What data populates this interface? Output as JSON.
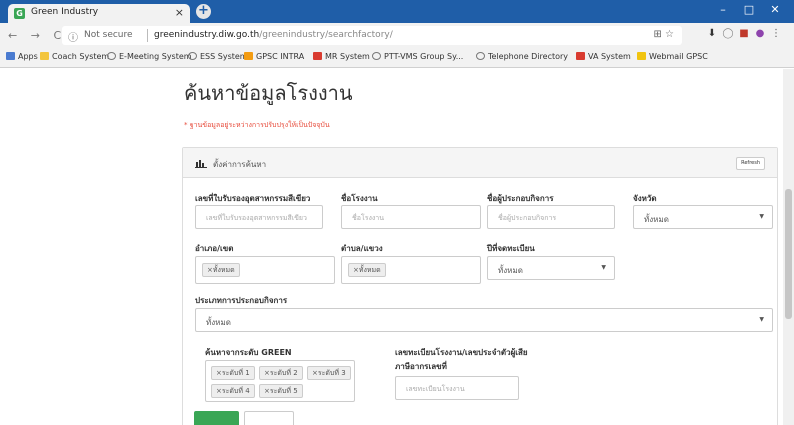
{
  "browser": {
    "tab_title": "Green Industry",
    "tab_favicon": "G",
    "nav": {
      "back": "←",
      "forward": "→",
      "reload": "C"
    },
    "omnibox": {
      "security_label": "Not secure",
      "url_host": "greenindustry.diw.go.th",
      "url_path": "/greenindustry/searchfactory/"
    },
    "bookmarks": [
      {
        "label": "Apps",
        "icon": "apps-icon"
      },
      {
        "label": "Coach System",
        "icon": "folder-icon"
      },
      {
        "label": "E-Meeting System",
        "icon": "globe-icon"
      },
      {
        "label": "ESS System",
        "icon": "globe-icon"
      },
      {
        "label": "GPSC INTRA",
        "icon": "folder-icon"
      },
      {
        "label": "MR System",
        "icon": "red-bar-icon"
      },
      {
        "label": "PTT-VMS Group Sy...",
        "icon": "globe-icon"
      },
      {
        "label": "Telephone Directory",
        "icon": "globe-icon"
      },
      {
        "label": "VA System",
        "icon": "red-bar-icon"
      },
      {
        "label": "Webmail GPSC",
        "icon": "yellow-icon"
      }
    ]
  },
  "page": {
    "heading": "ค้นหาข้อมูลโรงงาน",
    "note": "* ฐานข้อมูลอยู่ระหว่างการปรับปรุงให้เป็นปัจจุบัน",
    "panel_title": "ตั้งค่าการค้นหา",
    "refresh_label": "Refresh",
    "fields": {
      "green_cert_no": {
        "label": "เลขที่ใบรับรองอุตสาหกรรมสีเขียว",
        "placeholder": "เลขที่ใบรับรองอุตสาหกรรมสีเขียว"
      },
      "factory_name": {
        "label": "ชื่อโรงงาน",
        "placeholder": "ชื่อโรงงาน"
      },
      "operator_name": {
        "label": "ชื่อผู้ประกอบกิจการ",
        "placeholder": "ชื่อผู้ประกอบกิจการ"
      },
      "province": {
        "label": "จังหวัด",
        "value": "ทั้งหมด"
      },
      "district": {
        "label": "อำเภอ/เขต",
        "tags": [
          "×ทั้งหมด"
        ]
      },
      "subdistrict": {
        "label": "ตำบล/แขวง",
        "tags": [
          "×ทั้งหมด"
        ]
      },
      "reg_year": {
        "label": "ปีที่จดทะเบียน",
        "value": "ทั้งหมด"
      },
      "business_type": {
        "label": "ประเภทการประกอบกิจการ",
        "value": "ทั้งหมด"
      },
      "green_level": {
        "label": "ค้นหาจากระดับ GREEN",
        "tags": [
          "×ระดับที่ 1",
          "×ระดับที่ 2",
          "×ระดับที่ 3",
          "×ระดับที่ 4",
          "×ระดับที่ 5"
        ]
      },
      "factory_reg_no": {
        "label_line1": "เลขทะเบียนโรงงาน/เลขประจำตัวผู้เสีย",
        "label_line2": "ภาษีอากรเลขที่",
        "placeholder": "เลขทะเบียนโรงงาน"
      }
    }
  },
  "colors": {
    "tabstrip": "#1f5ea8",
    "green": "#3aa655",
    "note_red": "#e74c3c"
  }
}
